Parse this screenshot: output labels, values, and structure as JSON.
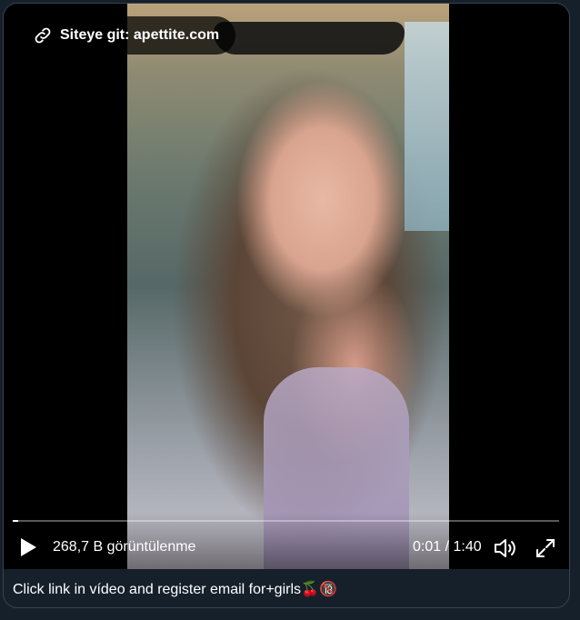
{
  "video": {
    "site_link_label": "Siteye git: apettite.com",
    "views_label": "268,7 B görüntülenme",
    "time_label": "0:01 / 1:40",
    "progress": 0.01
  },
  "tweet": {
    "caption_text": "Click link in vídeo and register email for+girls",
    "caption_emojis": "🍒🔞"
  },
  "icons": {
    "link": "link-icon",
    "play": "play-icon",
    "volume": "volume-icon",
    "fullscreen": "fullscreen-icon"
  },
  "colors": {
    "background": "#15202b",
    "border": "#38444d",
    "video_bg": "#000000",
    "pill_bg": "rgba(0,0,0,0.72)"
  }
}
